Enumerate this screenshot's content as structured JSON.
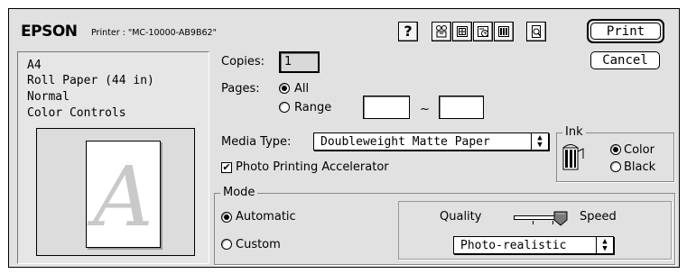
{
  "header": {
    "brand": "EPSON",
    "printer_label": "Printer : \"MC-10000-AB9B62\""
  },
  "toolbar": {
    "icons": [
      "help-icon",
      "utility-icon",
      "layout-icon",
      "background-print-icon",
      "status-monitor-icon",
      "preview-icon"
    ],
    "help_glyph": "?"
  },
  "buttons": {
    "print": "Print",
    "cancel": "Cancel"
  },
  "summary": {
    "lines": [
      "A4",
      "Roll Paper (44 in)",
      "Normal",
      "Color Controls"
    ],
    "preview_letter": "A"
  },
  "copies": {
    "label": "Copies:",
    "value": "1"
  },
  "pages": {
    "label": "Pages:",
    "all_label": "All",
    "range_label": "Range",
    "range_from": "",
    "range_to": "",
    "separator": "~",
    "selected": "All"
  },
  "media": {
    "label": "Media Type:",
    "value": "Doubleweight Matte Paper",
    "accelerator_label": "Photo Printing Accelerator",
    "accelerator_checked": true
  },
  "ink": {
    "title": "Ink",
    "color_label": "Color",
    "black_label": "Black",
    "selected": "Color"
  },
  "mode": {
    "title": "Mode",
    "automatic_label": "Automatic",
    "custom_label": "Custom",
    "selected": "Automatic",
    "quality_label": "Quality",
    "speed_label": "Speed",
    "quality_speed_level": 1.0,
    "preset_value": "Photo-realistic"
  },
  "colors": {
    "dialog_bg": "#e1e1e1",
    "page_bg": "#ffffff"
  }
}
